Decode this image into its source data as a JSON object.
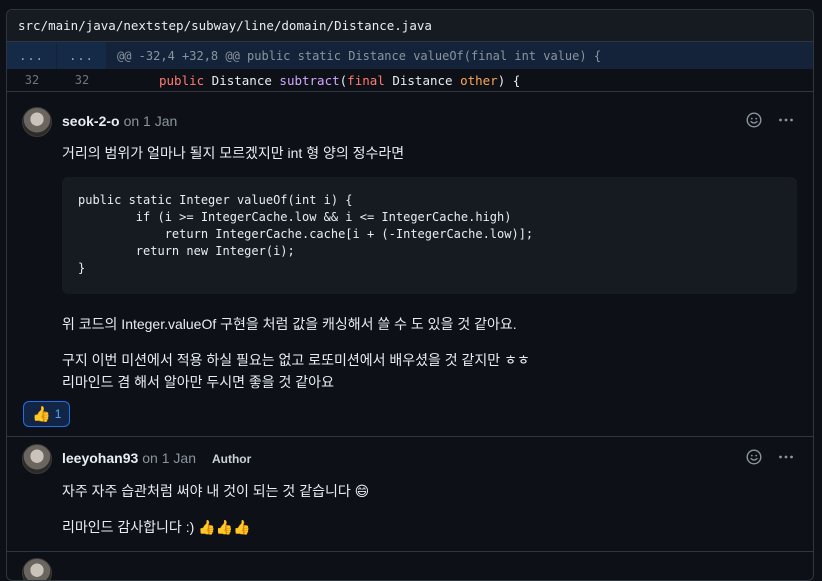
{
  "file": {
    "path": "src/main/java/nextstep/subway/line/domain/Distance.java"
  },
  "hunk": {
    "left": "...",
    "right": "...",
    "header": "@@ -32,4 +32,8 @@ public static Distance valueOf(final int value) {"
  },
  "code_line": {
    "left_num": "32",
    "right_num": "32",
    "t1": "public",
    "t2": " Distance ",
    "t3": "subtract",
    "t4": "(",
    "t5": "final",
    "t6": " Distance ",
    "t7": "other",
    "t8": ") {"
  },
  "comments": [
    {
      "author": "seok-2-o",
      "date": "on 1 Jan",
      "p1": "거리의 범위가 얼마나 될지 모르겠지만 int 형 양의 정수라면",
      "code": "public static Integer valueOf(int i) {\n        if (i >= IntegerCache.low && i <= IntegerCache.high)\n            return IntegerCache.cache[i + (-IntegerCache.low)];\n        return new Integer(i);\n}",
      "p2": "위 코드의 Integer.valueOf 구현을 처럼 값을 캐싱해서 쓸 수 도 있을 것 같아요.",
      "p3": "구지 이번 미션에서 적용 하실 필요는 없고 로또미션에서 배우셨을 것 같지만 ㅎㅎ",
      "p4": "리마인드 겸 해서 알아만 두시면 좋을 것 같아요",
      "reaction": {
        "emoji": "👍",
        "count": "1"
      }
    },
    {
      "author": "leeyohan93",
      "date": "on 1 Jan",
      "badge": "Author",
      "p1": "자주 자주 습관처럼 써야 내 것이 되는 것 같습니다 😄",
      "p2": "리마인드 감사합니다 :) 👍👍👍"
    }
  ],
  "icons": {
    "smiley": "smiley-icon",
    "kebab": "kebab-horizontal-icon"
  },
  "colors": {
    "background": "#0d1117",
    "accent": "#58a6ff",
    "border": "#30363d"
  }
}
